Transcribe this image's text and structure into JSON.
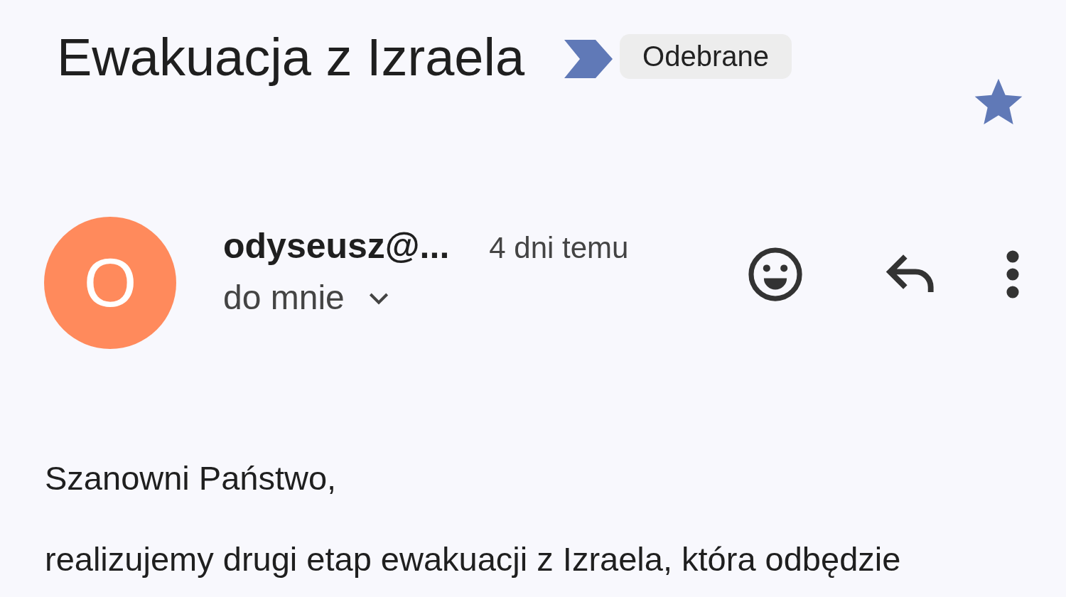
{
  "subject": {
    "title": "Ewakuacja z Izraela",
    "important": true,
    "label": "Odebrane",
    "starred": true
  },
  "message": {
    "avatar": {
      "letter": "O",
      "color": "#ff8a5c"
    },
    "sender": "odyseusz@...",
    "time": "4 dni temu",
    "recipient": "do mnie",
    "expanded": false
  },
  "body": [
    "Szanowni Państwo,",
    "realizujemy drugi etap ewakuacji z Izraela, która odbędzie"
  ]
}
